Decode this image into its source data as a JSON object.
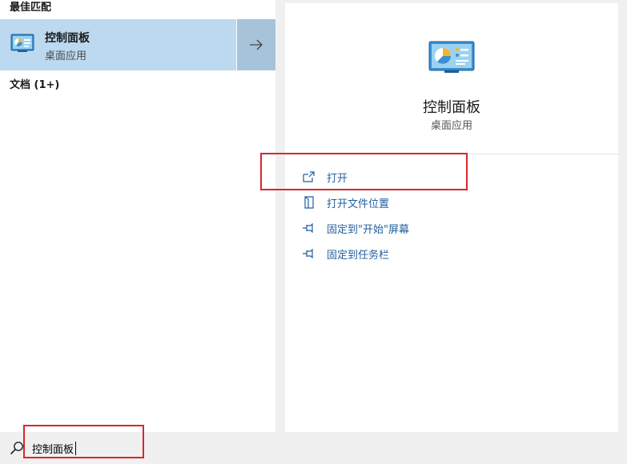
{
  "results": {
    "best_match_header": "最佳匹配",
    "best_match": {
      "title": "控制面板",
      "subtitle": "桌面应用",
      "icon": "control-panel-icon"
    },
    "documents_header": "文档 (1+)"
  },
  "details": {
    "title": "控制面板",
    "subtitle": "桌面应用",
    "actions": [
      {
        "label": "打开",
        "icon": "open-icon"
      },
      {
        "label": "打开文件位置",
        "icon": "file-location-icon"
      },
      {
        "label": "固定到\"开始\"屏幕",
        "icon": "pin-icon"
      },
      {
        "label": "固定到任务栏",
        "icon": "pin-icon"
      }
    ]
  },
  "search": {
    "value": "控制面板",
    "icon": "search-icon"
  },
  "colors": {
    "selected_bg": "#bcd9f0",
    "accent_link": "#1f5f9e",
    "annotation": "#d9262e"
  }
}
